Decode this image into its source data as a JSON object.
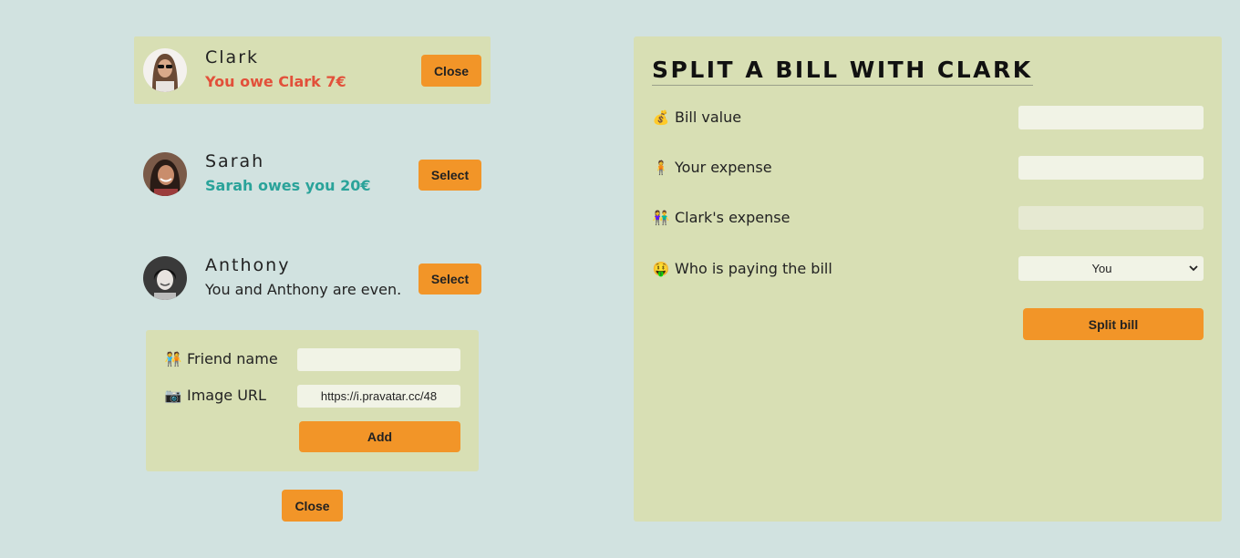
{
  "friends": [
    {
      "name": "Clark",
      "status": "You owe Clark 7€",
      "button_label": "Close",
      "selected": true
    },
    {
      "name": "Sarah",
      "status": "Sarah owes you 20€",
      "button_label": "Select",
      "selected": false
    },
    {
      "name": "Anthony",
      "status": "You and Anthony are even.",
      "button_label": "Select",
      "selected": false
    }
  ],
  "add_friend": {
    "name_label": "Friend name",
    "name_value": "",
    "image_label": "Image URL",
    "image_value": "https://i.pravatar.cc/48",
    "add_button": "Add",
    "close_button": "Close"
  },
  "split_bill": {
    "title": "SPLIT A BILL WITH CLARK",
    "bill_value_label": "Bill value",
    "your_expense_label": "Your expense",
    "friend_expense_label": "Clark's expense",
    "payer_label": "Who is paying the bill",
    "payer_selected": "You",
    "submit_label": "Split bill"
  },
  "colors": {
    "background": "#d1e2e0",
    "panel": "#d8dfb4",
    "accent": "#f29528",
    "owe_red": "#e2503a",
    "owed_green": "#2aa39a"
  },
  "icons": {
    "bill_value": "money-bag-icon",
    "your_expense": "person-standing-icon",
    "friend_expense": "couple-icon",
    "payer": "money-mouth-face-icon",
    "friend_name": "people-hugging-icon",
    "image_url": "camera-icon"
  }
}
